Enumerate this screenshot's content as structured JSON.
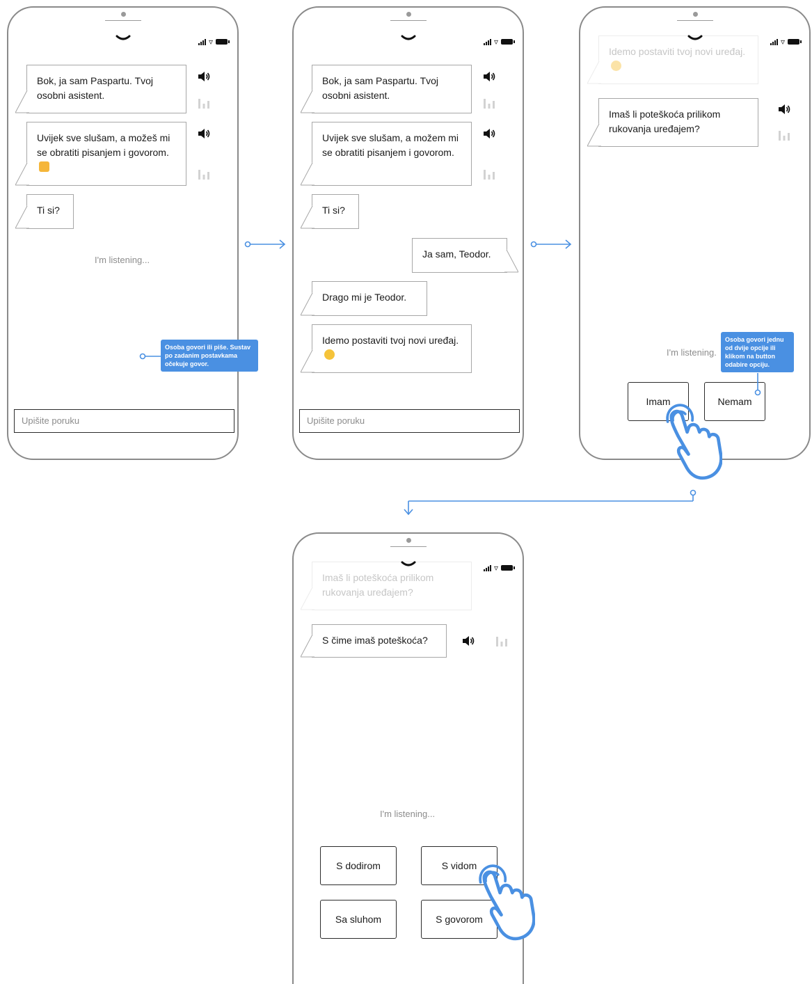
{
  "screens": [
    {
      "messages": [
        {
          "text": "Bok, ja sam Paspartu. Tvoj osobni asistent."
        },
        {
          "text": "Uvijek sve slušam, a možeš mi se obratiti pisanjem i govorom."
        },
        {
          "text": "Ti si?"
        }
      ],
      "listening": "I'm listening...",
      "input_placeholder": "Upišite poruku",
      "annotation": "Osoba govori ili piše. Sustav po zadanim postavkama očekuje govor."
    },
    {
      "messages": [
        {
          "text": "Bok, ja sam Paspartu. Tvoj osobni asistent."
        },
        {
          "text": "Uvijek sve slušam, a možem mi se obratiti pisanjem i govorom."
        },
        {
          "text": "Ti si?"
        },
        {
          "text": "Ja sam, Teodor."
        },
        {
          "text": "Drago mi je Teodor."
        },
        {
          "text": "Idemo postaviti tvoj novi uređaj."
        }
      ],
      "input_placeholder": "Upišite poruku"
    },
    {
      "messages": [
        {
          "text": "Idemo postaviti tvoj novi uređaj."
        },
        {
          "text": "Imaš li poteškoća prilikom rukovanja uređajem?"
        }
      ],
      "listening": "I'm listening.",
      "options": [
        "Imam",
        "Nemam"
      ],
      "annotation": "Osoba govori jednu od dvije opcije ili klikom na button odabire opciju."
    },
    {
      "messages": [
        {
          "text": "Imaš li poteškoća prilikom rukovanja uređajem?"
        },
        {
          "text": "S čime imaš poteškoća?"
        }
      ],
      "listening": "I'm listening...",
      "options": [
        "S dodirom",
        "S vidom",
        "Sa sluhom",
        "S govorom"
      ]
    }
  ],
  "colors": {
    "accent": "#4a90e2",
    "outline": "#8a8a8a",
    "faded_text": "#c6c6c6"
  },
  "icons": [
    "chevron-down-icon",
    "signal-icon",
    "wifi-icon",
    "battery-icon",
    "speaker-icon",
    "equalizer-icon",
    "hand-pointer-icon",
    "arrow-right-icon",
    "arrow-down-icon",
    "thumbs-up-emoji",
    "smile-emoji"
  ]
}
